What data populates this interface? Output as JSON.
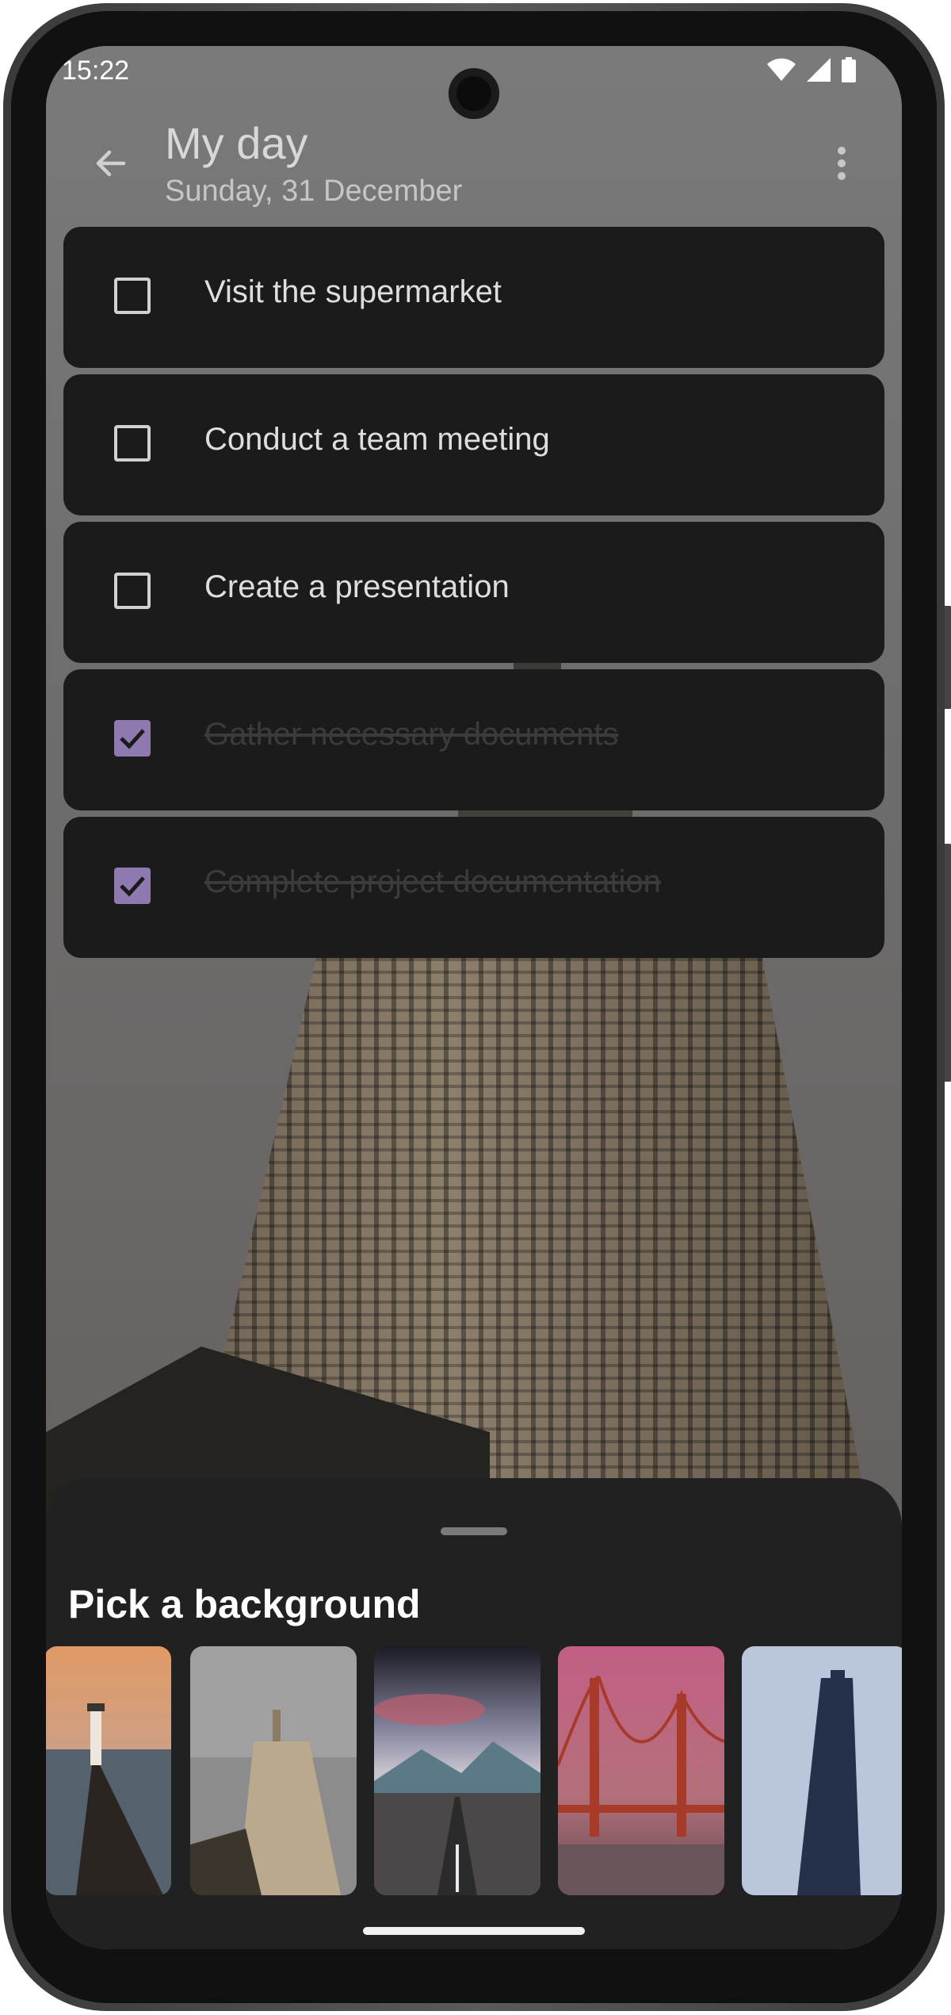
{
  "status_bar": {
    "time": "15:22"
  },
  "app_bar": {
    "title": "My day",
    "subtitle": "Sunday, 31 December"
  },
  "tasks": [
    {
      "label": "Visit the supermarket",
      "done": false
    },
    {
      "label": "Conduct a team meeting",
      "done": false
    },
    {
      "label": "Create a presentation",
      "done": false
    },
    {
      "label": "Gather necessary documents",
      "done": true
    },
    {
      "label": "Complete project documentation",
      "done": true
    }
  ],
  "background_picker": {
    "title": "Pick a background",
    "thumbnails": [
      "lighthouse-pier",
      "empire-state-building",
      "mountain-road",
      "golden-gate-bridge",
      "flatiron-building"
    ]
  },
  "colors": {
    "accent": "#8e7ab0",
    "card": "#1b1b1b",
    "sheet": "#212121"
  }
}
